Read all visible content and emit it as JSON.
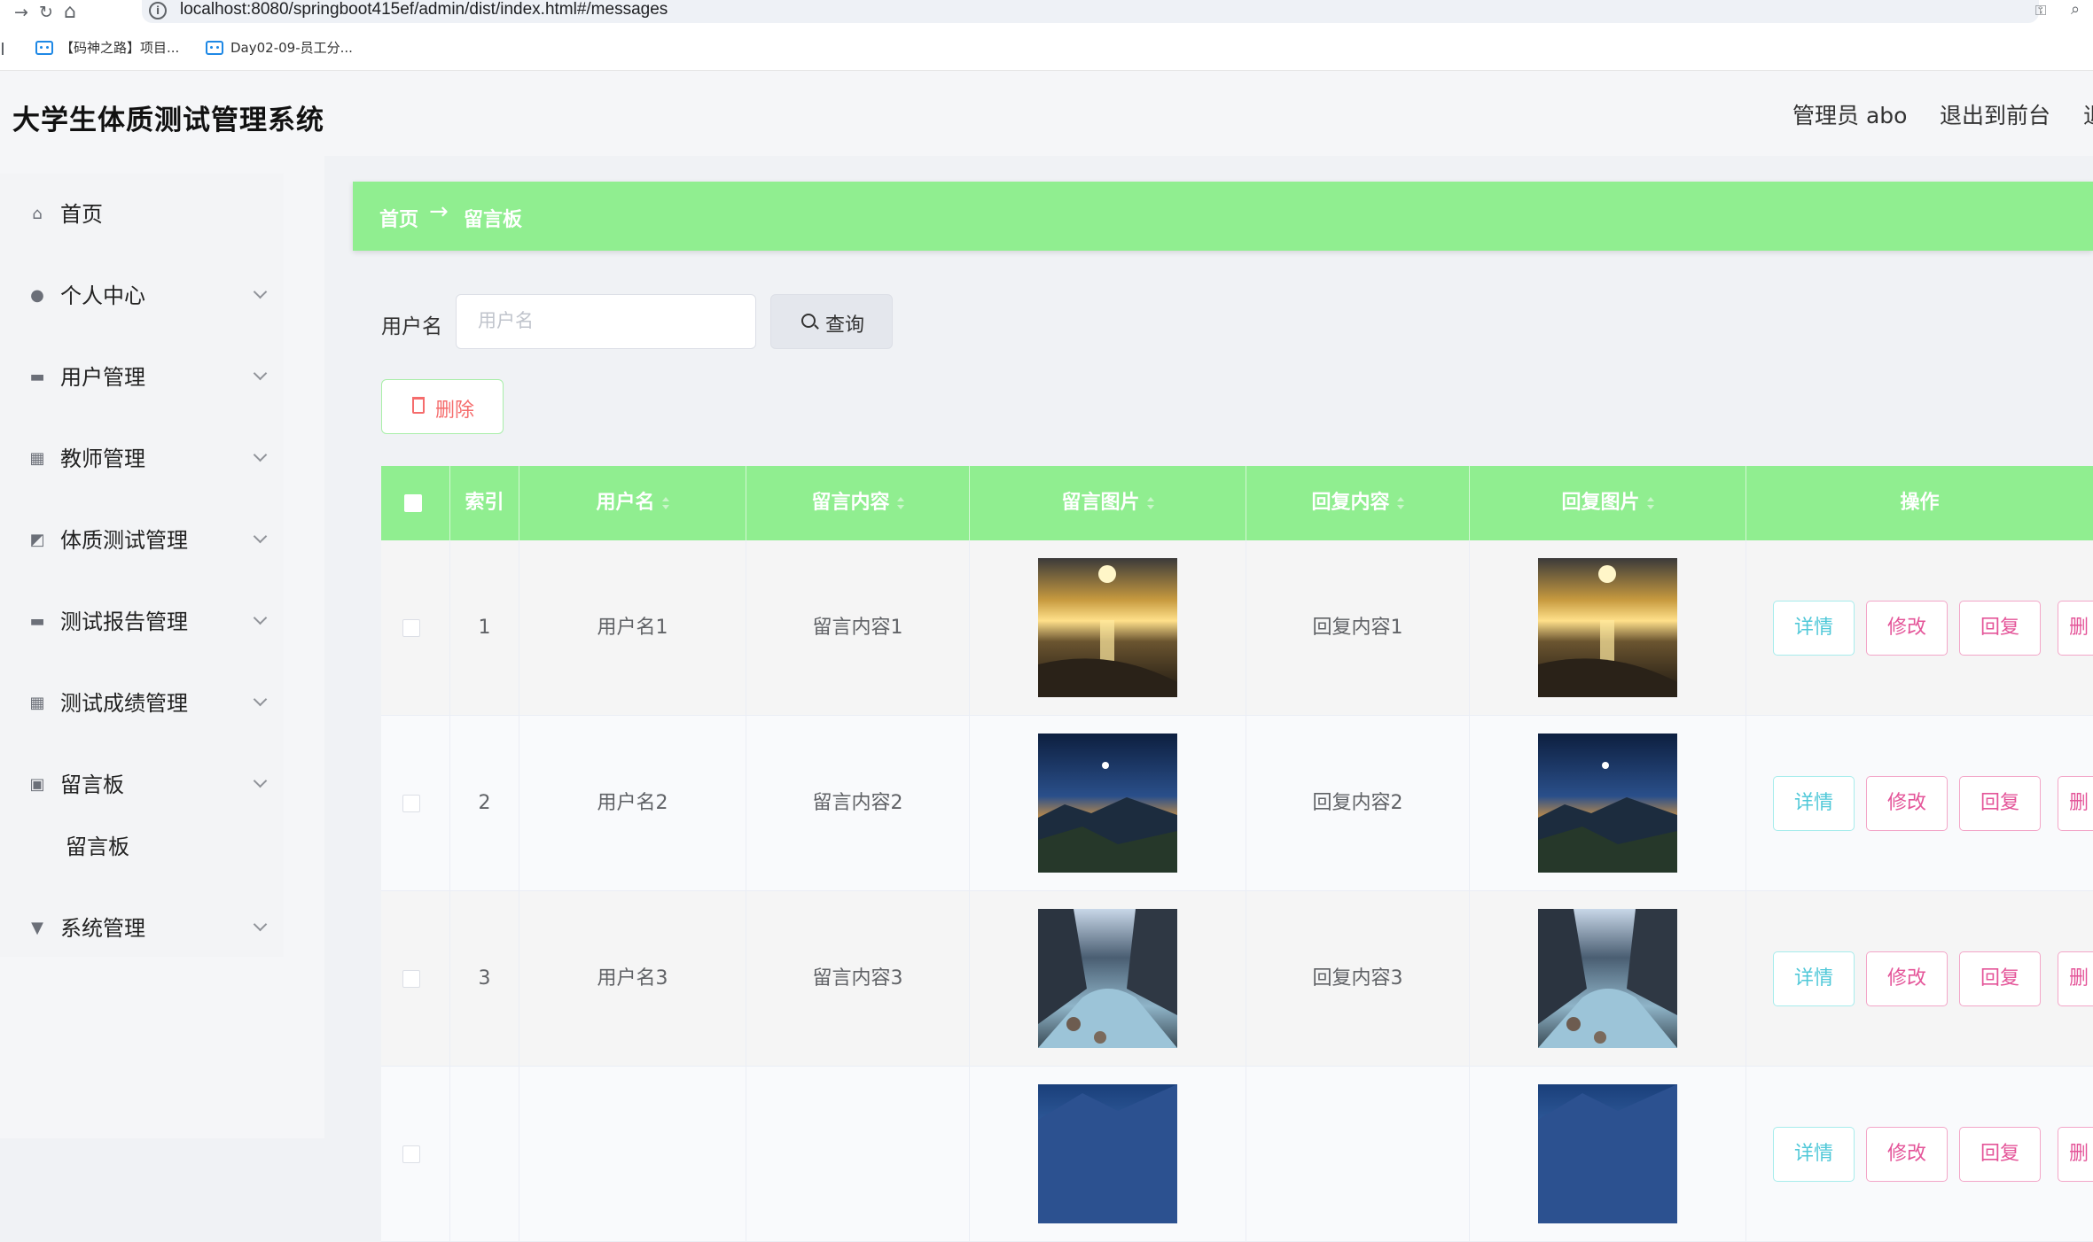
{
  "browser": {
    "back": "→",
    "reload": "↻",
    "home": "⌂",
    "url": "localhost:8080/springboot415ef/admin/dist/index.html#/messages",
    "bookmarks": [
      {
        "label": "【码神之路】项目..."
      },
      {
        "label": "Day02-09-员工分..."
      }
    ]
  },
  "header": {
    "title": "大学生体质测试管理系统",
    "user": "管理员 abo",
    "front": "退出到前台",
    "more": "退"
  },
  "sidebar": {
    "items": [
      {
        "label": "首页",
        "icon": "home-icon"
      },
      {
        "label": "个人中心",
        "icon": "user-icon"
      },
      {
        "label": "用户管理",
        "icon": "briefcase-icon"
      },
      {
        "label": "教师管理",
        "icon": "grid-icon"
      },
      {
        "label": "体质测试管理",
        "icon": "chart-icon"
      },
      {
        "label": "测试报告管理",
        "icon": "chat-icon"
      },
      {
        "label": "测试成绩管理",
        "icon": "grid-icon"
      },
      {
        "label": "留言板",
        "icon": "clipboard-icon"
      },
      {
        "label": "系统管理",
        "icon": "pin-icon"
      }
    ],
    "submenu_label": "留言板"
  },
  "breadcrumb": {
    "home": "首页",
    "arrow": "→",
    "current": "留言板"
  },
  "filter": {
    "label": "用户名",
    "placeholder": "用户名",
    "value": "",
    "query_label": "查询",
    "delete_label": "删除"
  },
  "table": {
    "columns": {
      "index": "索引",
      "username": "用户名",
      "content": "留言内容",
      "image": "留言图片",
      "reply": "回复内容",
      "reply_image": "回复图片",
      "ops": "操作"
    },
    "rows": [
      {
        "index": "1",
        "username": "用户名1",
        "content": "留言内容1",
        "reply": "回复内容1",
        "image": "sunset-sea"
      },
      {
        "index": "2",
        "username": "用户名2",
        "content": "留言内容2",
        "reply": "回复内容2",
        "image": "night-mountain"
      },
      {
        "index": "3",
        "username": "用户名3",
        "content": "留言内容3",
        "reply": "回复内容3",
        "image": "mountain-river"
      },
      {
        "index": "",
        "username": "",
        "content": "",
        "reply": "",
        "image": "blue-mountain"
      }
    ],
    "op_labels": {
      "detail": "详情",
      "edit": "修改",
      "reply": "回复",
      "delete": "删"
    }
  },
  "colors": {
    "accent_green": "#90ee90",
    "detail_text": "#50c8d8",
    "edit_text": "#e45599",
    "delete_text": "#f56c6c"
  }
}
